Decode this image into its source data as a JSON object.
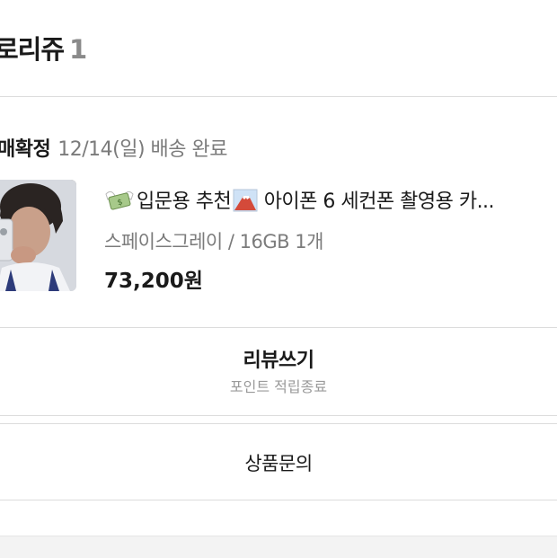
{
  "header": {
    "title": "로리쥬",
    "count": "1"
  },
  "order": {
    "status_label": "매확정",
    "status_date": "12/14(일) 배송 완료",
    "product": {
      "name_part1": "입문용 추천",
      "name_part2": " 아이폰 6 세컨폰 촬영용 카...",
      "emoji1": "money-with-wings-icon",
      "emoji2": "mount-fuji-icon",
      "option": "스페이스그레이 / 16GB 1개",
      "price": "73,200원"
    }
  },
  "actions": {
    "review_label": "리뷰쓰기",
    "review_sub": "포인트 적립종료",
    "inquiry_label": "상품문의"
  },
  "colors": {
    "divider": "#dcdcdc",
    "muted_text": "#7b7b7b",
    "primary_text": "#1a1a1a"
  }
}
